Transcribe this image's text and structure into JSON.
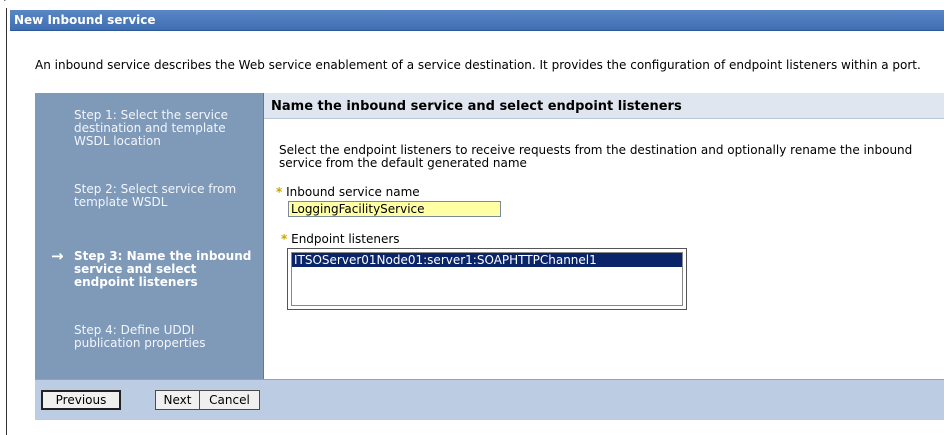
{
  "window": {
    "corner_mark": "ʽ",
    "title": "New Inbound service"
  },
  "description": "An inbound service describes the Web service enablement of a service destination. It provides the configuration of endpoint listeners within a port.",
  "steps": [
    {
      "label": "Step 1: Select the service destination and template WSDL location",
      "active": false
    },
    {
      "label": "Step 2: Select service from template WSDL",
      "active": false
    },
    {
      "label": "Step 3: Name the inbound service and select endpoint listeners",
      "active": true
    },
    {
      "label": "Step 4: Define UDDI publication properties",
      "active": false
    }
  ],
  "current_step_marker": "→",
  "content": {
    "title": "Name the inbound service and select endpoint listeners",
    "instructions": "Select the endpoint listeners to receive requests from the destination and optionally rename the inbound service from the default generated name",
    "required_marker": "*",
    "inbound_name_label": "Inbound service name",
    "inbound_name_value": "LoggingFacilityService",
    "endpoint_label": "Endpoint listeners",
    "endpoint_options": [
      "ITSOServer01Node01:server1:SOAPHTTPChannel1"
    ],
    "endpoint_selected": "ITSOServer01Node01:server1:SOAPHTTPChannel1"
  },
  "buttons": {
    "previous": "Previous",
    "next": "Next",
    "cancel": "Cancel"
  },
  "colors": {
    "title_bar": "#4a79bb",
    "steps_panel": "#7f99b9",
    "content_header": "#dfe6f0",
    "button_bar": "#bccde3",
    "input_highlight": "#ffffa3",
    "selected_option": "#0a246a",
    "required_marker": "#c9a300"
  }
}
